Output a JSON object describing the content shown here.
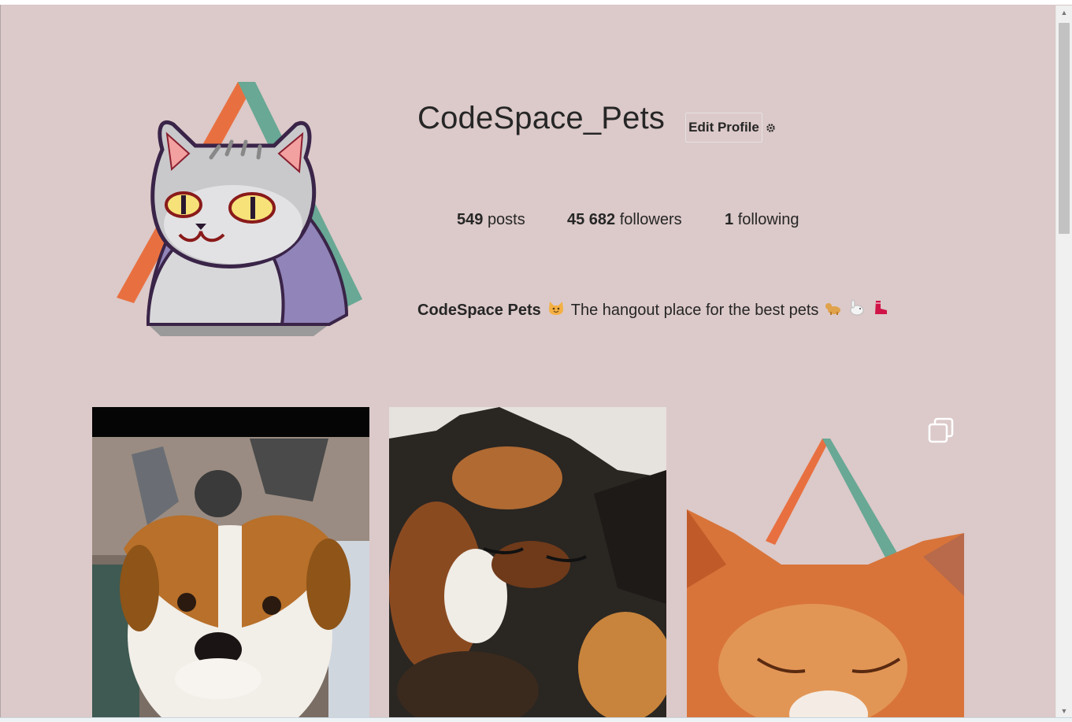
{
  "profile": {
    "username": "CodeSpace_Pets",
    "edit_label": "Edit Profile",
    "settings_icon": "gear-icon",
    "stats": {
      "posts_count": "549",
      "posts_label": "posts",
      "followers_count": "45 682",
      "followers_label": "followers",
      "following_count": "1",
      "following_label": "following"
    },
    "bio": {
      "name": "CodeSpace Pets",
      "text": "The hangout place for the best pets"
    }
  },
  "posts": [
    {
      "subject": "dog photo"
    },
    {
      "subject": "calico cat photo"
    },
    {
      "subject": "orange cat photo",
      "multi": true
    }
  ]
}
